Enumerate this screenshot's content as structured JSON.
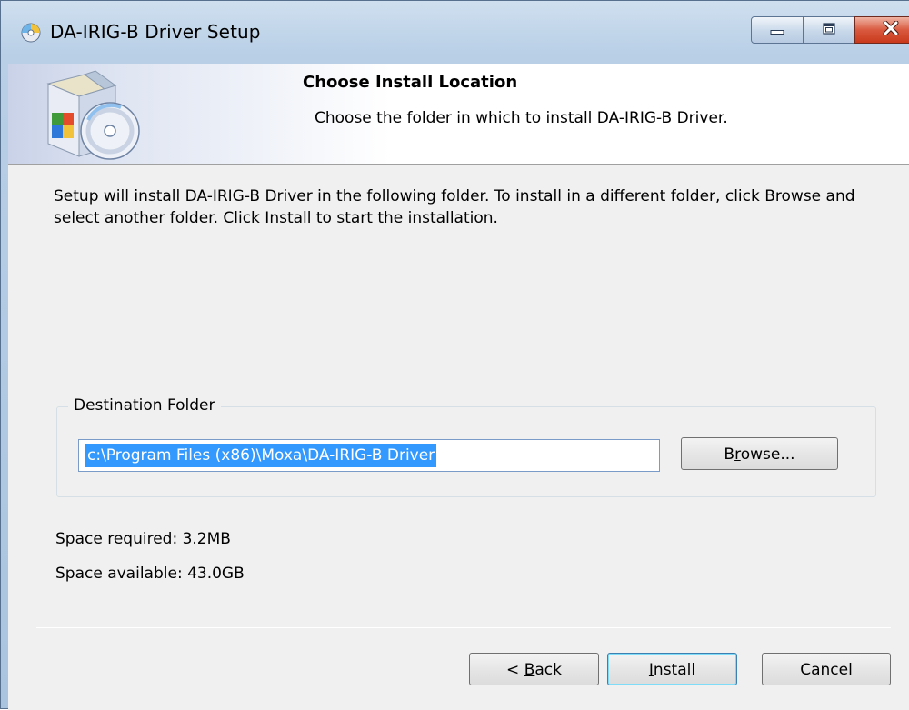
{
  "window": {
    "title": "DA-IRIG-B Driver Setup"
  },
  "header": {
    "title": "Choose Install Location",
    "subtitle": "Choose the folder in which to install DA-IRIG-B Driver."
  },
  "intro_text": "Setup will install DA-IRIG-B Driver in the following folder. To install in a different folder, click Browse and select another folder. Click Install to start the installation.",
  "destination": {
    "group_label": "Destination Folder",
    "path_value": "c:\\Program Files (x86)\\Moxa\\DA-IRIG-B Driver",
    "browse_label_pre": "B",
    "browse_label_u": "r",
    "browse_label_post": "owse..."
  },
  "space": {
    "required": "Space required: 3.2MB",
    "available": "Space available: 43.0GB"
  },
  "buttons": {
    "back_pre": "< ",
    "back_u": "B",
    "back_post": "ack",
    "install_u": "I",
    "install_post": "nstall",
    "cancel": "Cancel"
  },
  "icons": {
    "app": "setup-disc-icon",
    "header_art": "installer-box-disc-icon",
    "minimize": "minimize-icon",
    "maximize": "maximize-icon",
    "close": "close-icon"
  },
  "colors": {
    "title_bar": "#b8cfe6",
    "selection": "#3399ff",
    "close_button": "#c9391b",
    "dialog_bg": "#f0f0f0"
  }
}
